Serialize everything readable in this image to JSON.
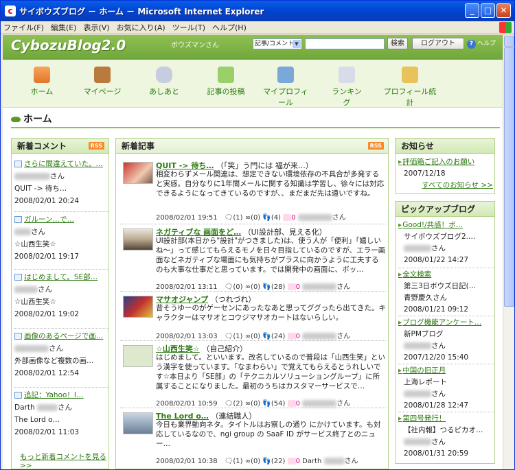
{
  "window": {
    "title": "サイボウズブログ － ホーム － Microsoft Internet Explorer"
  },
  "menu": [
    "ファイル(F)",
    "編集(E)",
    "表示(V)",
    "お気に入り(A)",
    "ツール(T)",
    "ヘルプ(H)"
  ],
  "header": {
    "logo": "CybozuBlog2.0",
    "user": "ボウズマンさん",
    "search_select": "記事/コメント",
    "search_button": "検索",
    "logout_button": "ログアウト",
    "help": "ヘルプ"
  },
  "nav": [
    "ホーム",
    "マイページ",
    "あしあと",
    "記事の投稿",
    "マイプロフィール",
    "ランキング",
    "プロフィール統計"
  ],
  "page_title": "ホーム",
  "comments": {
    "title": "新着コメント",
    "rss": "RSS",
    "items": [
      {
        "link": "さらに間違えていた。…",
        "name_suffix": "さん",
        "sub": "QUIT -> 待ち…",
        "date": "2008/02/01 20:24"
      },
      {
        "link": "ガルーン…で…",
        "name_suffix": "さん",
        "sub": "☆山西生笑☆",
        "date": "2008/02/01 19:17"
      },
      {
        "link": "はじめまして。SE部…",
        "name_suffix": "さん",
        "sub": "☆山西生笑☆",
        "date": "2008/02/01 19:02"
      },
      {
        "link": "画像のあるページで画…",
        "name_suffix": "さん",
        "sub": "外部画像など複数の画…",
        "date": "2008/02/01 12:54"
      },
      {
        "link": "追記：Yahoo！I…",
        "name_prefix": "Darth",
        "name_suffix": "さん",
        "sub": "The Lord o…",
        "date": "2008/02/01 11:03"
      }
    ],
    "more": "もっと新着コメントを見る>>"
  },
  "articles": {
    "title": "新着記事",
    "rss": "RSS",
    "items": [
      {
        "title": "QUIT -> 待ち…",
        "cat": "（「笑」う門には 福が来…）",
        "body": "相変わらずメール関連は、想定できない環境依存の不具合が多発すると実感。自分なりに1年間メールに関する知識は学習し、徐々には対応できるようになってきているのですが、、まだまだ先は遠いですね。",
        "date": "2008/02/01 19:51",
        "c1": "(1)",
        "c2": "(0)",
        "c3": "(4)",
        "c4": "0",
        "suffix": "さん"
      },
      {
        "title": "ネガティブな 画面をど…",
        "cat": "（UI設計部、見える化）",
        "body": "UI設計部(本日から\"設計\"がつきました)は、使う人が「便利」「嬉しいね～」って感じてもらえるモノを日々目指しているのですが、エラー画面などネガティブな場面にも気持ちがプラスに向かうように工夫するのも大事な仕事だと思っています。では開発中の画面に、ボッ…",
        "date": "2008/02/01 13:11",
        "c1": "(0)",
        "c2": "(0)",
        "c3": "(28)",
        "c4": "0",
        "suffix": "さん"
      },
      {
        "title": "マサオジャンプ",
        "cat": "（つれづれ）",
        "body": "昔そうゆーのがゲーセンにあったなあと思ってググったら出てきた。キャラクターはマサオとコウジマサオカートはないらしい。",
        "date": "2008/02/01 13:03",
        "c1": "(1)",
        "c2": "(0)",
        "c3": "(24)",
        "c4": "0",
        "suffix": "さん"
      },
      {
        "title": "☆山西生笑☆",
        "cat": "（自己紹介）",
        "body": "はじめまして。といいます。改名しているので普段は「山西生笑」という漢字を使っています。「なまわらい」で覚えてもらえるとうれしいです☆本日より「SE部」の「テクニカルソリューショングループ」に所属することになりました。最初のうちはカスタマーサービスで…",
        "date": "2008/02/01 10:59",
        "c1": "(2)",
        "c2": "(0)",
        "c3": "(54)",
        "c4": "0",
        "suffix": "さん"
      },
      {
        "title": "The Lord o…",
        "cat": "（連結職人）",
        "body": "今日も業界動向ネタ。タイトルはお察しの通り にかけています。も対応しているなので、ngi group の SaaF ID がサービス終了とのニュー…",
        "date": "2008/02/01 10:38",
        "c1": "(1)",
        "c2": "(0)",
        "c3": "(22)",
        "c4": "0",
        "prefix": "Darth",
        "suffix": "さん"
      }
    ]
  },
  "notice": {
    "title": "お知らせ",
    "item": "評価箱ご記入のお願い",
    "date": "2007/12/18",
    "more": "すべてのお知らせ >>"
  },
  "pickup": {
    "title": "ピックアップブログ",
    "items": [
      {
        "link": "Good!/共感！ボ…",
        "blog": "サイボウズブログ2.…",
        "name_suffix": "さん",
        "date": "2008/01/22 14:27"
      },
      {
        "link": "全文検索",
        "blog": "第三3日ボウズ日記(…",
        "name": "青野慶久さん",
        "date": "2008/01/21 09:12"
      },
      {
        "link": "ブログ機能アンケート…",
        "blog": "新PMブログ",
        "name_suffix": "さん",
        "date": "2007/12/20 15:40"
      },
      {
        "link": "中国の旧正月",
        "blog": "上海レポート",
        "name_suffix": "さん",
        "date": "2008/01/28 12:47"
      },
      {
        "link": "第四号発行！",
        "blog": "【社内報】つるピカオ…",
        "name_suffix": "さん",
        "date": "2008/01/31 20:59"
      }
    ]
  },
  "colors": {
    "accent": "#6fa63a",
    "link": "#2c7a10",
    "title_bar": "#0a5fe6"
  }
}
